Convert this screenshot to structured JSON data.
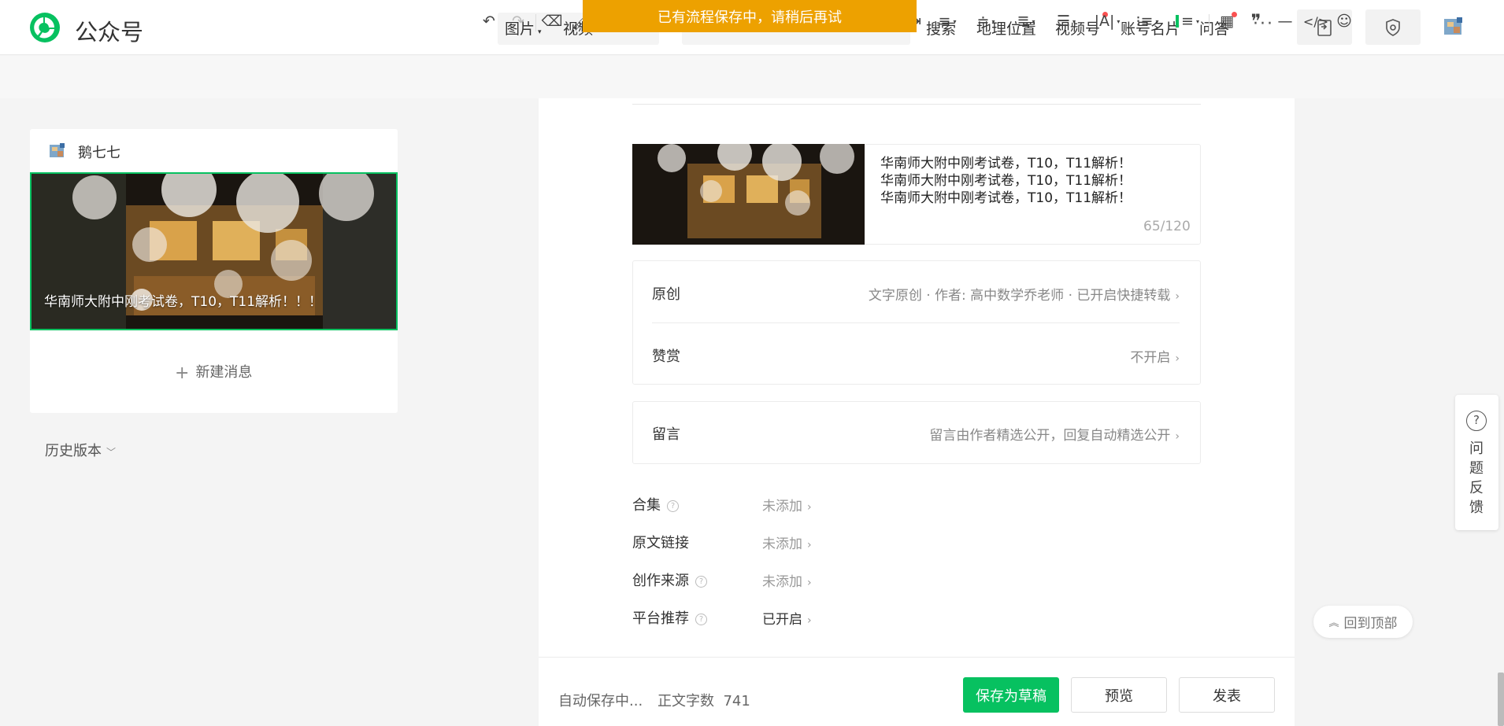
{
  "header": {
    "brand": "公众号",
    "toast": "已有流程保存中，请稍后再试",
    "nav": {
      "image": "图片",
      "video": "视频",
      "search": "搜索",
      "location": "地理位置",
      "channels": "视频号",
      "card": "账号名片",
      "qa": "问答",
      "more": "···"
    },
    "icons": [
      "paste-icon",
      "shield-icon",
      "avatar"
    ]
  },
  "toolbar": {
    "font_size": "16px"
  },
  "sidebar": {
    "account_name": "鹅七七",
    "cover_title": "华南师大附中刚考试卷，T10，T11解析！！！",
    "new_message": "新建消息",
    "history": "历史版本"
  },
  "article": {
    "digest_lines": [
      "华南师大附中刚考试卷，T10，T11解析！",
      "华南师大附中刚考试卷，T10，T11解析！",
      "华南师大附中刚考试卷，T10，T11解析！"
    ],
    "digest_count": "65/120",
    "original": {
      "label": "原创",
      "value": "文字原创 · 作者: 高中数学乔老师 · 已开启快捷转载"
    },
    "reward": {
      "label": "赞赏",
      "value": "不开启"
    },
    "comments": {
      "label": "留言",
      "value": "留言由作者精选公开，回复自动精选公开"
    },
    "options": [
      {
        "label": "合集",
        "value": "未添加",
        "help": true
      },
      {
        "label": "原文链接",
        "value": "未添加",
        "help": false
      },
      {
        "label": "创作来源",
        "value": "未添加",
        "help": true
      },
      {
        "label": "平台推荐",
        "value": "已开启",
        "help": true
      }
    ]
  },
  "footer": {
    "autosave": "自动保存中...",
    "word_count_label": "正文字数",
    "word_count": "741",
    "save_draft": "保存为草稿",
    "preview": "预览",
    "publish": "发表"
  },
  "float": {
    "feedback": "问题反馈",
    "back_top": "回到顶部"
  },
  "colors": {
    "accent": "#07c160",
    "toast": "#eda100",
    "badge": "#fa5151"
  }
}
